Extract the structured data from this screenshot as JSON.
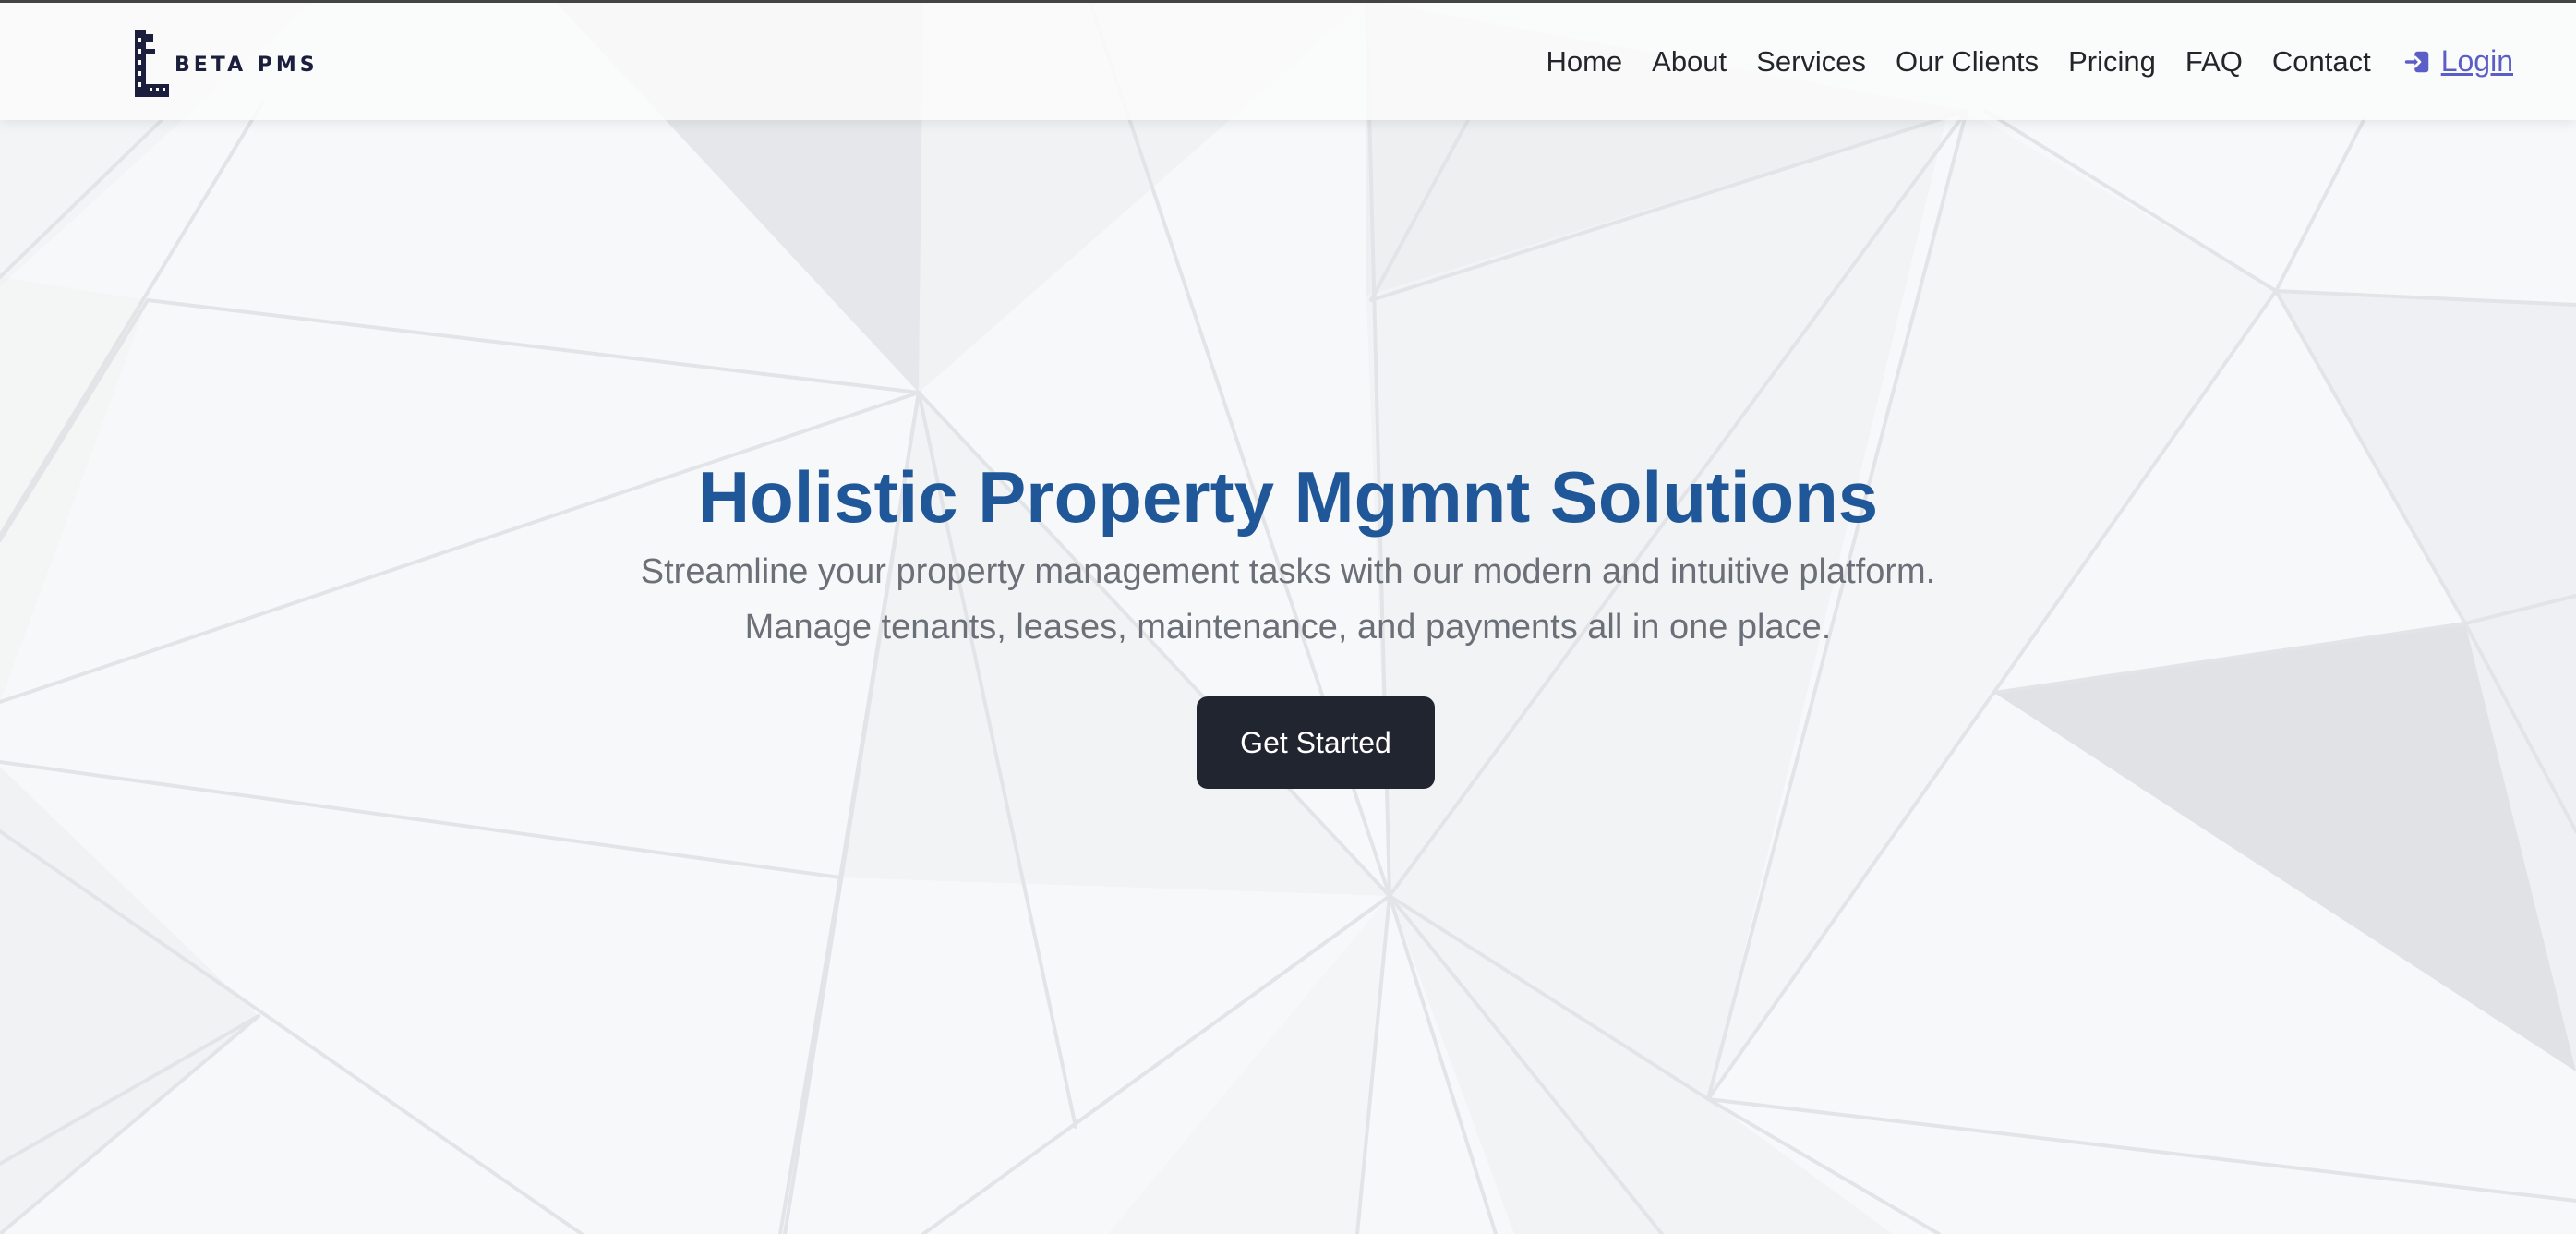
{
  "brand": {
    "logo_text": "BETA PMS"
  },
  "nav": {
    "links": [
      "Home",
      "About",
      "Services",
      "Our Clients",
      "Pricing",
      "FAQ",
      "Contact"
    ],
    "login_label": "Login",
    "login_icon": "login-arrow-icon"
  },
  "hero": {
    "title": "Holistic Property Mgmnt Solutions",
    "subtitle_line1": "Streamline your property management tasks with our modern and intuitive platform.",
    "subtitle_line2": "Manage tenants, leases, maintenance, and payments all in one place.",
    "cta_label": "Get Started"
  },
  "colors": {
    "title": "#1f5798",
    "subtitle": "#6b7078",
    "cta_background": "#212530",
    "login_accent": "#5c5ec8",
    "nav_text": "#23252b"
  }
}
